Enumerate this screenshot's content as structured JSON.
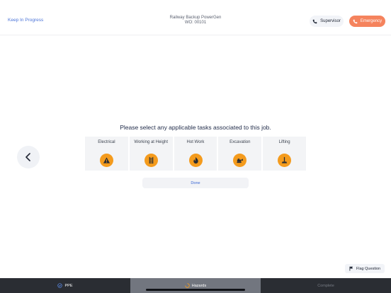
{
  "header": {
    "keep_in_progress": "Keep In Progress",
    "title": "Railway Backup PowerGen",
    "wo": "WO: 00101",
    "supervisor_label": "Supervisor",
    "emergency_label": "Emergency"
  },
  "question": "Please select any applicable tasks associated to this job.",
  "tasks": [
    {
      "label": "Electrical",
      "icon": "warning-triangle-icon"
    },
    {
      "label": "Working at Height",
      "icon": "ladder-icon"
    },
    {
      "label": "Hot Work",
      "icon": "flame-icon"
    },
    {
      "label": "Excavation",
      "icon": "excavator-icon"
    },
    {
      "label": "Lifting",
      "icon": "crane-hook-icon"
    }
  ],
  "done_label": "Done",
  "flag_label": "Flag Question",
  "tabs": [
    {
      "label": "PPE",
      "state": "done"
    },
    {
      "label": "Hazards",
      "state": "active"
    },
    {
      "label": "Complete",
      "state": "disabled"
    }
  ],
  "colors": {
    "accent_blue": "#4a73d8",
    "emergency": "#f5835d",
    "task_icon": "#f49b1d",
    "tabbar": "#2a2d33",
    "tab_active": "#72767f"
  }
}
